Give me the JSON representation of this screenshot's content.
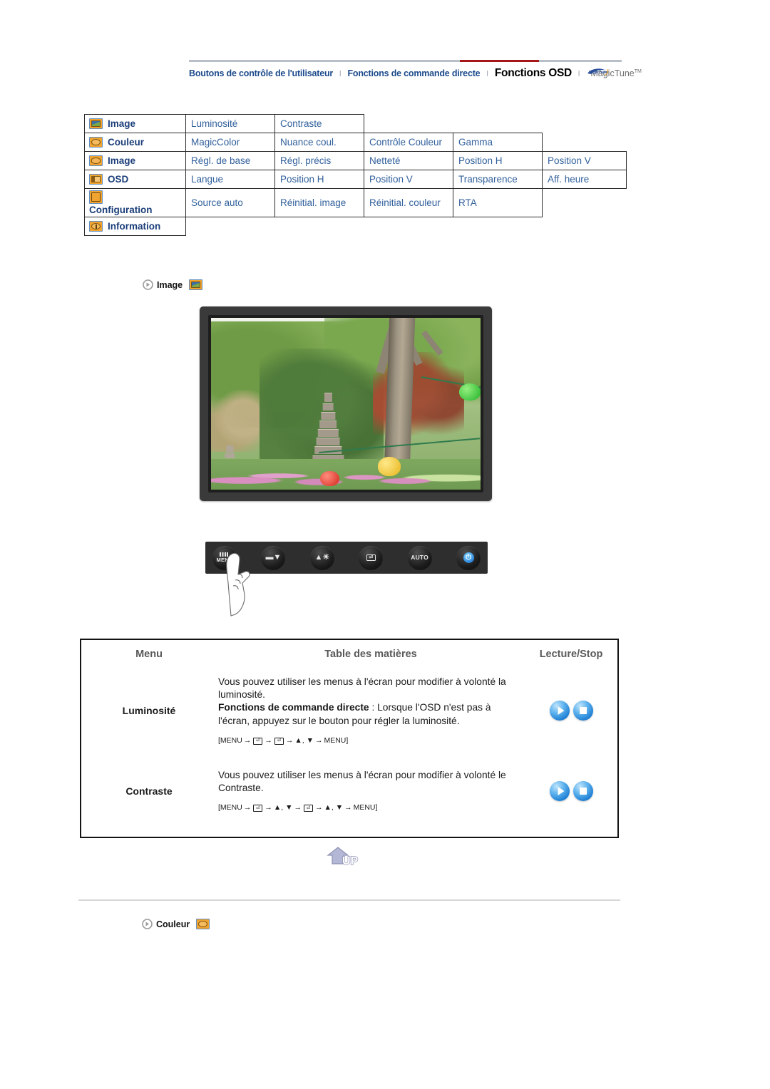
{
  "header": {
    "links": [
      {
        "label": "Boutons de contrôle de l'utilisateur",
        "active": false
      },
      {
        "label": "Fonctions de commande directe",
        "active": false
      },
      {
        "label": "Fonctions OSD",
        "active": true
      }
    ],
    "separator": "l",
    "brand": "MagicTune",
    "brand_tm": "TM",
    "brand_logo_icon": "magictune-swoosh-icon",
    "active_underline_color": "#a51616",
    "link_color": "#1b4a8c"
  },
  "osd_matrix": {
    "rows": [
      {
        "icon": "image-icon",
        "category": "Image",
        "items": [
          "Luminosité",
          "Contraste"
        ]
      },
      {
        "icon": "color-palette-icon",
        "category": "Couleur",
        "items": [
          "MagicColor",
          "Nuance coul.",
          "Contrôle Couleur",
          "Gamma"
        ]
      },
      {
        "icon": "geometry-icon",
        "category": "Image",
        "items": [
          "Régl. de base",
          "Régl. précis",
          "Netteté",
          "Position H",
          "Position V"
        ]
      },
      {
        "icon": "osd-icon",
        "category": "OSD",
        "items": [
          "Langue",
          "Position H",
          "Position V",
          "Transparence",
          "Aff. heure"
        ]
      },
      {
        "icon": "sliders-icon",
        "category": "Configuration",
        "items": [
          "Source auto",
          "Réinitial. image",
          "Réinitial. couleur",
          "RTA"
        ]
      },
      {
        "icon": "information-icon",
        "category": "Information",
        "items": []
      }
    ],
    "text_color": "#31609c"
  },
  "sections": [
    {
      "bullet_icon": "bullet-arrow-icon",
      "label": "Image",
      "badge_icon": "image-icon"
    },
    {
      "bullet_icon": "bullet-arrow-icon",
      "label": "Couleur",
      "badge_icon": "color-palette-icon"
    }
  ],
  "monitor": {
    "alt": "Aperçu écran — jardin avec pagode et lanternes"
  },
  "control_buttons": [
    {
      "name": "menu-button",
      "label": "MENU",
      "icon": "menu-bars-icon"
    },
    {
      "name": "down-button",
      "label": "",
      "icon": "down-arrow-icon"
    },
    {
      "name": "up-brightness-button",
      "label": "",
      "icon": "up-brightness-icon"
    },
    {
      "name": "enter-button",
      "label": "",
      "icon": "enter-icon"
    },
    {
      "name": "auto-button",
      "label": "AUTO",
      "icon": "auto-icon"
    },
    {
      "name": "power-button",
      "label": "",
      "icon": "power-icon"
    }
  ],
  "table": {
    "headers": {
      "menu": "Menu",
      "contents": "Table des matières",
      "playstop": "Lecture/Stop"
    },
    "rows": [
      {
        "menu": "Luminosité",
        "line1": "Vous pouvez utiliser les menus à l'écran pour modifier à volonté la luminosité.",
        "bold": "Fonctions de commande directe",
        "line2": " : Lorsque l'OSD n'est pas à l'écran, appuyez sur le bouton pour régler la luminosité.",
        "sequence": [
          "[MENU",
          "→",
          "⏎",
          "→",
          "⏎",
          "→",
          "▲, ▼",
          "→",
          "MENU]"
        ],
        "play_icon": "play-icon",
        "stop_icon": "stop-icon"
      },
      {
        "menu": "Contraste",
        "line1": "Vous pouvez utiliser les menus à l'écran pour modifier à volonté le Contraste.",
        "bold": "",
        "line2": "",
        "sequence": [
          "[MENU",
          "→",
          "⏎",
          "→",
          "▲, ▼",
          "→",
          "⏎",
          "→",
          "▲, ▼",
          "→",
          "MENU]"
        ],
        "play_icon": "play-icon",
        "stop_icon": "stop-icon"
      }
    ]
  },
  "up_button": {
    "label": "UP",
    "icon": "up-arrow-icon"
  }
}
